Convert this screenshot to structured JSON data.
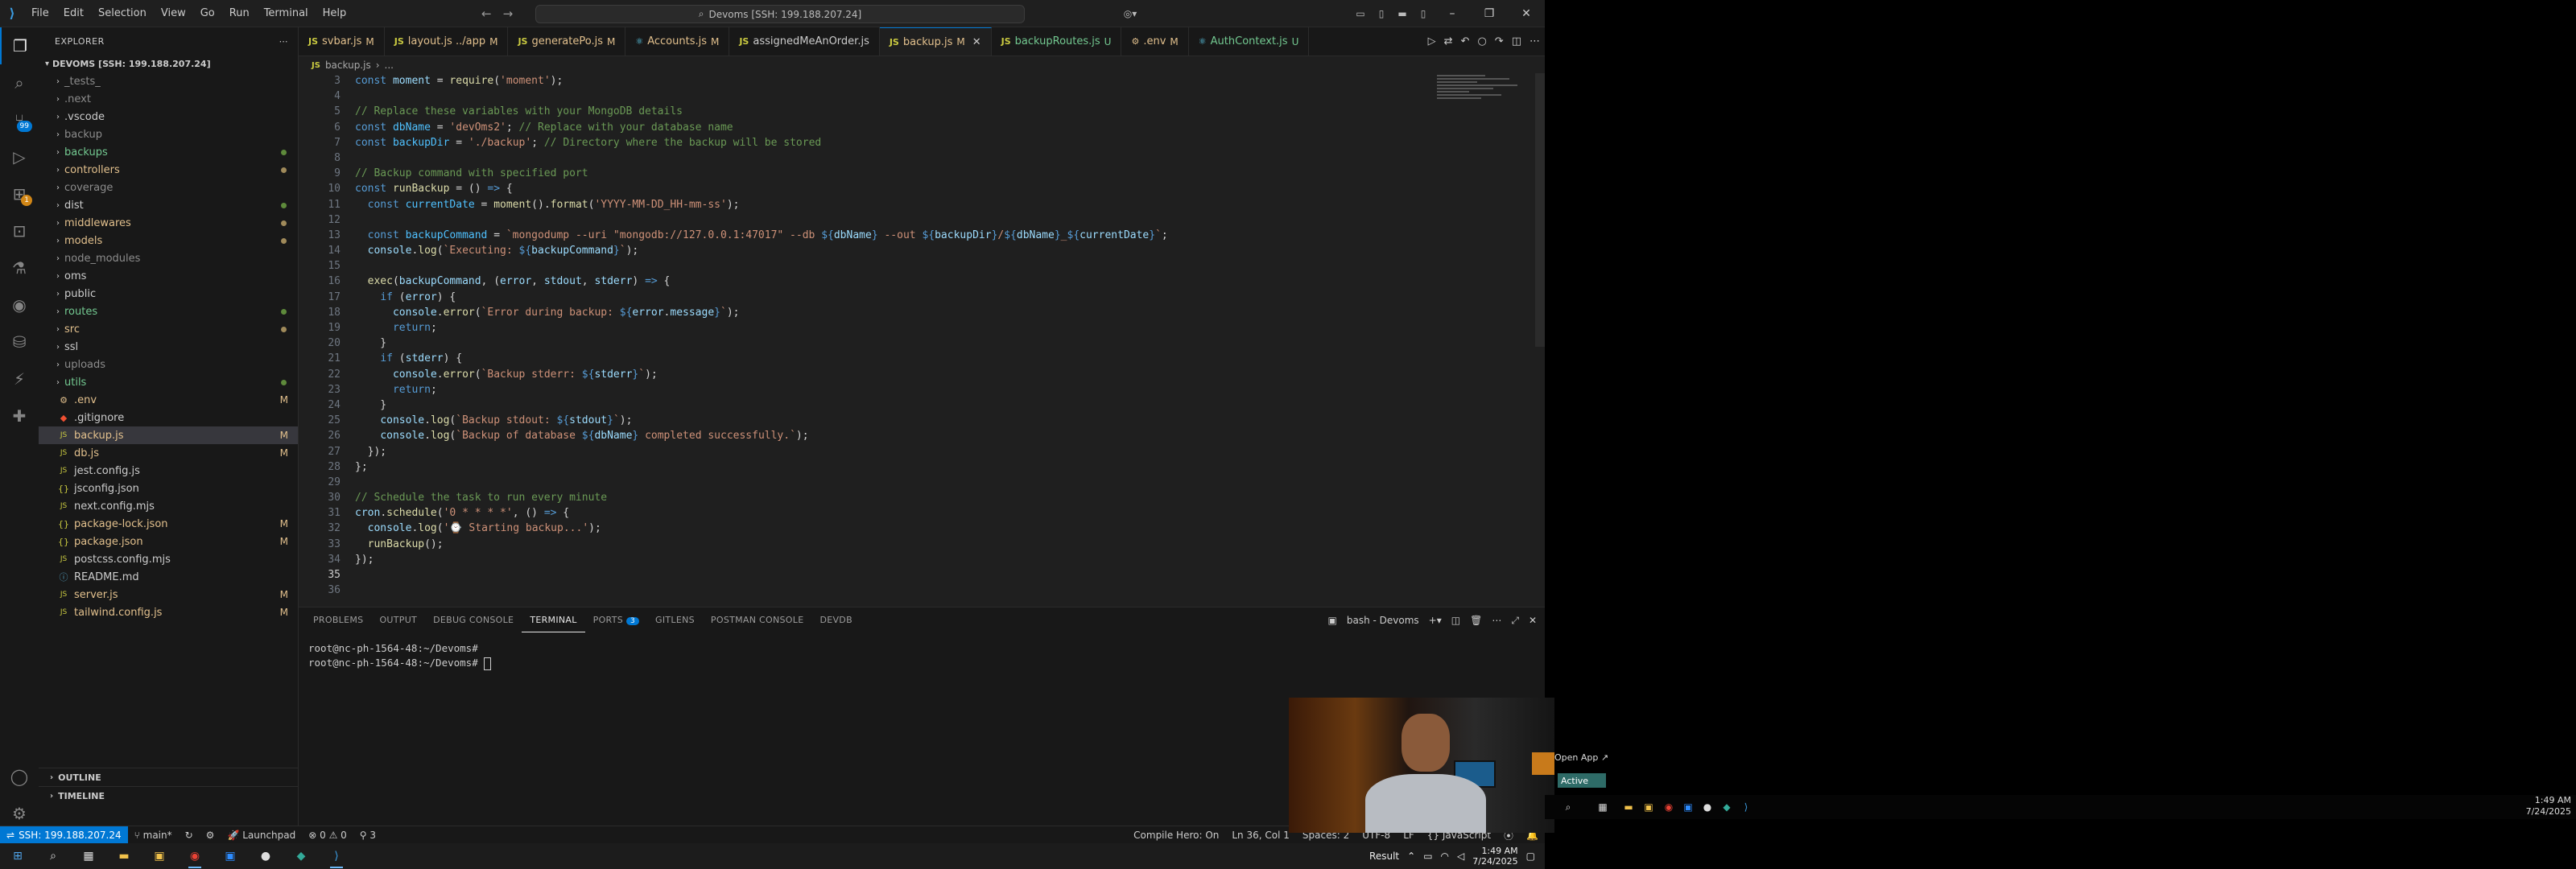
{
  "menu": [
    "File",
    "Edit",
    "Selection",
    "View",
    "Go",
    "Run",
    "Terminal",
    "Help"
  ],
  "command_center": "Devoms [SSH: 199.188.207.24]",
  "explorer": {
    "title": "EXPLORER",
    "root": "DEVOMS [SSH: 199.188.207.24]",
    "items": [
      {
        "name": "_tests_",
        "type": "folder",
        "cls": "gitignored",
        "status": ""
      },
      {
        "name": ".next",
        "type": "folder",
        "cls": "gitignored",
        "status": ""
      },
      {
        "name": ".vscode",
        "type": "folder",
        "cls": "",
        "status": ""
      },
      {
        "name": "backup",
        "type": "folder",
        "cls": "gitignored",
        "status": ""
      },
      {
        "name": "backups",
        "type": "folder",
        "cls": "untracked",
        "status": "dot"
      },
      {
        "name": "controllers",
        "type": "folder",
        "cls": "modified",
        "status": "dot"
      },
      {
        "name": "coverage",
        "type": "folder",
        "cls": "gitignored",
        "status": ""
      },
      {
        "name": "dist",
        "type": "folder",
        "cls": "",
        "status": "dot"
      },
      {
        "name": "middlewares",
        "type": "folder",
        "cls": "modified",
        "status": "dot"
      },
      {
        "name": "models",
        "type": "folder",
        "cls": "modified",
        "status": "dot"
      },
      {
        "name": "node_modules",
        "type": "folder",
        "cls": "gitignored",
        "status": ""
      },
      {
        "name": "oms",
        "type": "folder",
        "cls": "",
        "status": ""
      },
      {
        "name": "public",
        "type": "folder",
        "cls": "",
        "status": ""
      },
      {
        "name": "routes",
        "type": "folder",
        "cls": "untracked",
        "status": "dot"
      },
      {
        "name": "src",
        "type": "folder",
        "cls": "modified",
        "status": "dot"
      },
      {
        "name": "ssl",
        "type": "folder",
        "cls": "",
        "status": ""
      },
      {
        "name": "uploads",
        "type": "folder",
        "cls": "gitignored",
        "status": ""
      },
      {
        "name": "utils",
        "type": "folder",
        "cls": "untracked",
        "status": "dot"
      },
      {
        "name": ".env",
        "type": "file",
        "icon": "⚙",
        "cls": "modified",
        "status": "M"
      },
      {
        "name": ".gitignore",
        "type": "file",
        "icon": "◆",
        "cls": "",
        "status": ""
      },
      {
        "name": "backup.js",
        "type": "file",
        "icon": "JS",
        "cls": "modified",
        "status": "M",
        "selected": true
      },
      {
        "name": "db.js",
        "type": "file",
        "icon": "JS",
        "cls": "modified",
        "status": "M"
      },
      {
        "name": "jest.config.js",
        "type": "file",
        "icon": "JS",
        "cls": "",
        "status": ""
      },
      {
        "name": "jsconfig.json",
        "type": "file",
        "icon": "{}",
        "cls": "",
        "status": ""
      },
      {
        "name": "next.config.mjs",
        "type": "file",
        "icon": "JS",
        "cls": "",
        "status": ""
      },
      {
        "name": "package-lock.json",
        "type": "file",
        "icon": "{}",
        "cls": "modified",
        "status": "M"
      },
      {
        "name": "package.json",
        "type": "file",
        "icon": "{}",
        "cls": "modified",
        "status": "M"
      },
      {
        "name": "postcss.config.mjs",
        "type": "file",
        "icon": "JS",
        "cls": "",
        "status": ""
      },
      {
        "name": "README.md",
        "type": "file",
        "icon": "ⓘ",
        "cls": "",
        "status": ""
      },
      {
        "name": "server.js",
        "type": "file",
        "icon": "JS",
        "cls": "modified",
        "status": "M"
      },
      {
        "name": "tailwind.config.js",
        "type": "file",
        "icon": "JS",
        "cls": "modified",
        "status": "M"
      }
    ],
    "outline": "OUTLINE",
    "timeline": "TIMELINE"
  },
  "tabs": [
    {
      "label": "svbar.js",
      "icon": "JS",
      "status": "M",
      "st": "tm"
    },
    {
      "label": "layout.js ../app",
      "icon": "JS",
      "status": "M",
      "st": "tm"
    },
    {
      "label": "generatePo.js",
      "icon": "JS",
      "status": "M",
      "st": "tm"
    },
    {
      "label": "Accounts.js",
      "icon": "⚛",
      "status": "M",
      "st": "tm"
    },
    {
      "label": "assignedMeAnOrder.js",
      "icon": "JS",
      "status": "",
      "st": ""
    },
    {
      "label": "backup.js",
      "icon": "JS",
      "status": "M",
      "st": "tm",
      "active": true
    },
    {
      "label": "backupRoutes.js",
      "icon": "JS",
      "status": "U",
      "st": "tu"
    },
    {
      "label": ".env",
      "icon": "⚙",
      "status": "M",
      "st": "tm"
    },
    {
      "label": "AuthContext.js",
      "icon": "⚛",
      "status": "U",
      "st": "tu"
    }
  ],
  "breadcrumb": {
    "icon": "JS",
    "file": "backup.js",
    "more": "..."
  },
  "code": [
    {
      "n": 3,
      "t": [
        [
          "k",
          "const "
        ],
        [
          "v",
          "moment"
        ],
        [
          "p",
          " = "
        ],
        [
          "f",
          "require"
        ],
        [
          "p",
          "("
        ],
        [
          "s",
          "'moment'"
        ],
        [
          "p",
          ");"
        ]
      ]
    },
    {
      "n": 4,
      "t": []
    },
    {
      "n": 5,
      "t": [
        [
          "c",
          "// Replace these variables with your MongoDB details"
        ]
      ]
    },
    {
      "n": 6,
      "t": [
        [
          "k",
          "const "
        ],
        [
          "cn",
          "dbName"
        ],
        [
          "p",
          " = "
        ],
        [
          "s",
          "'devOms2'"
        ],
        [
          "p",
          "; "
        ],
        [
          "c",
          "// Replace with your database name"
        ]
      ]
    },
    {
      "n": 7,
      "t": [
        [
          "k",
          "const "
        ],
        [
          "cn",
          "backupDir"
        ],
        [
          "p",
          " = "
        ],
        [
          "s",
          "'./backup'"
        ],
        [
          "p",
          "; "
        ],
        [
          "c",
          "// Directory where the backup will be stored"
        ]
      ]
    },
    {
      "n": 8,
      "t": []
    },
    {
      "n": 9,
      "t": [
        [
          "c",
          "// Backup command with specified port"
        ]
      ]
    },
    {
      "n": 10,
      "t": [
        [
          "k",
          "const "
        ],
        [
          "f",
          "runBackup"
        ],
        [
          "p",
          " = () "
        ],
        [
          "k",
          "=>"
        ],
        [
          "p",
          " {"
        ]
      ]
    },
    {
      "n": 11,
      "t": [
        [
          "p",
          "  "
        ],
        [
          "k",
          "const "
        ],
        [
          "cn",
          "currentDate"
        ],
        [
          "p",
          " = "
        ],
        [
          "f",
          "moment"
        ],
        [
          "p",
          "()."
        ],
        [
          "f",
          "format"
        ],
        [
          "p",
          "("
        ],
        [
          "s",
          "'YYYY-MM-DD_HH-mm-ss'"
        ],
        [
          "p",
          ");"
        ]
      ]
    },
    {
      "n": 12,
      "t": []
    },
    {
      "n": 13,
      "t": [
        [
          "p",
          "  "
        ],
        [
          "k",
          "const "
        ],
        [
          "cn",
          "backupCommand"
        ],
        [
          "p",
          " = "
        ],
        [
          "s",
          "`mongodump --uri \"mongodb://127.0.0.1:47017\" --db "
        ],
        [
          "k",
          "${"
        ],
        [
          "v",
          "dbName"
        ],
        [
          "k",
          "}"
        ],
        [
          "s",
          " --out "
        ],
        [
          "k",
          "${"
        ],
        [
          "v",
          "backupDir"
        ],
        [
          "k",
          "}"
        ],
        [
          "s",
          "/"
        ],
        [
          "k",
          "${"
        ],
        [
          "v",
          "dbName"
        ],
        [
          "k",
          "}"
        ],
        [
          "s",
          "_"
        ],
        [
          "k",
          "${"
        ],
        [
          "v",
          "currentDate"
        ],
        [
          "k",
          "}"
        ],
        [
          "s",
          "`"
        ],
        [
          "p",
          ";"
        ]
      ]
    },
    {
      "n": 14,
      "t": [
        [
          "p",
          "  "
        ],
        [
          "v",
          "console"
        ],
        [
          "p",
          "."
        ],
        [
          "f",
          "log"
        ],
        [
          "p",
          "("
        ],
        [
          "s",
          "`Executing: "
        ],
        [
          "k",
          "${"
        ],
        [
          "v",
          "backupCommand"
        ],
        [
          "k",
          "}"
        ],
        [
          "s",
          "`"
        ],
        [
          "p",
          ");"
        ]
      ]
    },
    {
      "n": 15,
      "t": []
    },
    {
      "n": 16,
      "t": [
        [
          "p",
          "  "
        ],
        [
          "f",
          "exec"
        ],
        [
          "p",
          "("
        ],
        [
          "v",
          "backupCommand"
        ],
        [
          "p",
          ", ("
        ],
        [
          "v",
          "error"
        ],
        [
          "p",
          ", "
        ],
        [
          "v",
          "stdout"
        ],
        [
          "p",
          ", "
        ],
        [
          "v",
          "stderr"
        ],
        [
          "p",
          ") "
        ],
        [
          "k",
          "=>"
        ],
        [
          "p",
          " {"
        ]
      ]
    },
    {
      "n": 17,
      "t": [
        [
          "p",
          "    "
        ],
        [
          "k",
          "if"
        ],
        [
          "p",
          " ("
        ],
        [
          "v",
          "error"
        ],
        [
          "p",
          ") {"
        ]
      ]
    },
    {
      "n": 18,
      "t": [
        [
          "p",
          "      "
        ],
        [
          "v",
          "console"
        ],
        [
          "p",
          "."
        ],
        [
          "f",
          "error"
        ],
        [
          "p",
          "("
        ],
        [
          "s",
          "`Error during backup: "
        ],
        [
          "k",
          "${"
        ],
        [
          "v",
          "error"
        ],
        [
          "p",
          "."
        ],
        [
          "v",
          "message"
        ],
        [
          "k",
          "}"
        ],
        [
          "s",
          "`"
        ],
        [
          "p",
          ");"
        ]
      ]
    },
    {
      "n": 19,
      "t": [
        [
          "p",
          "      "
        ],
        [
          "k",
          "return"
        ],
        [
          "p",
          ";"
        ]
      ]
    },
    {
      "n": 20,
      "t": [
        [
          "p",
          "    }"
        ]
      ]
    },
    {
      "n": 21,
      "t": [
        [
          "p",
          "    "
        ],
        [
          "k",
          "if"
        ],
        [
          "p",
          " ("
        ],
        [
          "v",
          "stderr"
        ],
        [
          "p",
          ") {"
        ]
      ]
    },
    {
      "n": 22,
      "t": [
        [
          "p",
          "      "
        ],
        [
          "v",
          "console"
        ],
        [
          "p",
          "."
        ],
        [
          "f",
          "error"
        ],
        [
          "p",
          "("
        ],
        [
          "s",
          "`Backup stderr: "
        ],
        [
          "k",
          "${"
        ],
        [
          "v",
          "stderr"
        ],
        [
          "k",
          "}"
        ],
        [
          "s",
          "`"
        ],
        [
          "p",
          ");"
        ]
      ]
    },
    {
      "n": 23,
      "t": [
        [
          "p",
          "      "
        ],
        [
          "k",
          "return"
        ],
        [
          "p",
          ";"
        ]
      ]
    },
    {
      "n": 24,
      "t": [
        [
          "p",
          "    }"
        ]
      ]
    },
    {
      "n": 25,
      "t": [
        [
          "p",
          "    "
        ],
        [
          "v",
          "console"
        ],
        [
          "p",
          "."
        ],
        [
          "f",
          "log"
        ],
        [
          "p",
          "("
        ],
        [
          "s",
          "`Backup stdout: "
        ],
        [
          "k",
          "${"
        ],
        [
          "v",
          "stdout"
        ],
        [
          "k",
          "}"
        ],
        [
          "s",
          "`"
        ],
        [
          "p",
          ");"
        ]
      ]
    },
    {
      "n": 26,
      "t": [
        [
          "p",
          "    "
        ],
        [
          "v",
          "console"
        ],
        [
          "p",
          "."
        ],
        [
          "f",
          "log"
        ],
        [
          "p",
          "("
        ],
        [
          "s",
          "`Backup of database "
        ],
        [
          "k",
          "${"
        ],
        [
          "v",
          "dbName"
        ],
        [
          "k",
          "}"
        ],
        [
          "s",
          " completed successfully.`"
        ],
        [
          "p",
          ");"
        ]
      ]
    },
    {
      "n": 27,
      "t": [
        [
          "p",
          "  });"
        ]
      ]
    },
    {
      "n": 28,
      "t": [
        [
          "p",
          "};"
        ]
      ]
    },
    {
      "n": 29,
      "t": []
    },
    {
      "n": 30,
      "t": [
        [
          "c",
          "// Schedule the task to run every minute"
        ]
      ]
    },
    {
      "n": 31,
      "t": [
        [
          "v",
          "cron"
        ],
        [
          "p",
          "."
        ],
        [
          "f",
          "schedule"
        ],
        [
          "p",
          "("
        ],
        [
          "s",
          "'0 * * * *'"
        ],
        [
          "p",
          ", () "
        ],
        [
          "k",
          "=>"
        ],
        [
          "p",
          " {"
        ]
      ]
    },
    {
      "n": 32,
      "t": [
        [
          "p",
          "  "
        ],
        [
          "v",
          "console"
        ],
        [
          "p",
          "."
        ],
        [
          "f",
          "log"
        ],
        [
          "p",
          "("
        ],
        [
          "s",
          "'⌚ Starting backup...'"
        ],
        [
          "p",
          ");"
        ]
      ]
    },
    {
      "n": 33,
      "t": [
        [
          "p",
          "  "
        ],
        [
          "f",
          "runBackup"
        ],
        [
          "p",
          "();"
        ]
      ]
    },
    {
      "n": 34,
      "t": [
        [
          "p",
          "});"
        ]
      ]
    },
    {
      "n": 35,
      "t": []
    },
    {
      "n": 36,
      "t": []
    }
  ],
  "current_line": 35,
  "panel": {
    "tabs": [
      {
        "label": "PROBLEMS"
      },
      {
        "label": "OUTPUT"
      },
      {
        "label": "DEBUG CONSOLE"
      },
      {
        "label": "TERMINAL",
        "active": true
      },
      {
        "label": "PORTS",
        "badge": "3"
      },
      {
        "label": "GITLENS"
      },
      {
        "label": "POSTMAN CONSOLE"
      },
      {
        "label": "DEVDB"
      }
    ],
    "terminal_name": "bash - Devoms",
    "lines": [
      "root@nc-ph-1564-48:~/Devoms# ",
      "root@nc-ph-1564-48:~/Devoms# "
    ]
  },
  "statusbar": {
    "remote": "SSH: 199.188.207.24",
    "branch": "main*",
    "launchpad": "Launchpad",
    "problems": "0 ⚠ 0",
    "ports": "3",
    "compile_hero": "Compile Hero: On",
    "position": "Ln 36, Col 1",
    "spaces": "Spaces: 2",
    "encoding": "UTF-8",
    "eol": "LF",
    "language": "JavaScript"
  },
  "taskbar": {
    "result": "Result",
    "time": "1:49 AM",
    "date": "7/24/2025"
  },
  "overlay": {
    "open_app": "Open App ↗",
    "active": "Active"
  },
  "right_screen": {
    "time": "1:49 AM",
    "date": "7/24/2025"
  },
  "colors": {
    "accent": "#0078d4",
    "modified": "#e2c08d",
    "untracked": "#73c991"
  }
}
